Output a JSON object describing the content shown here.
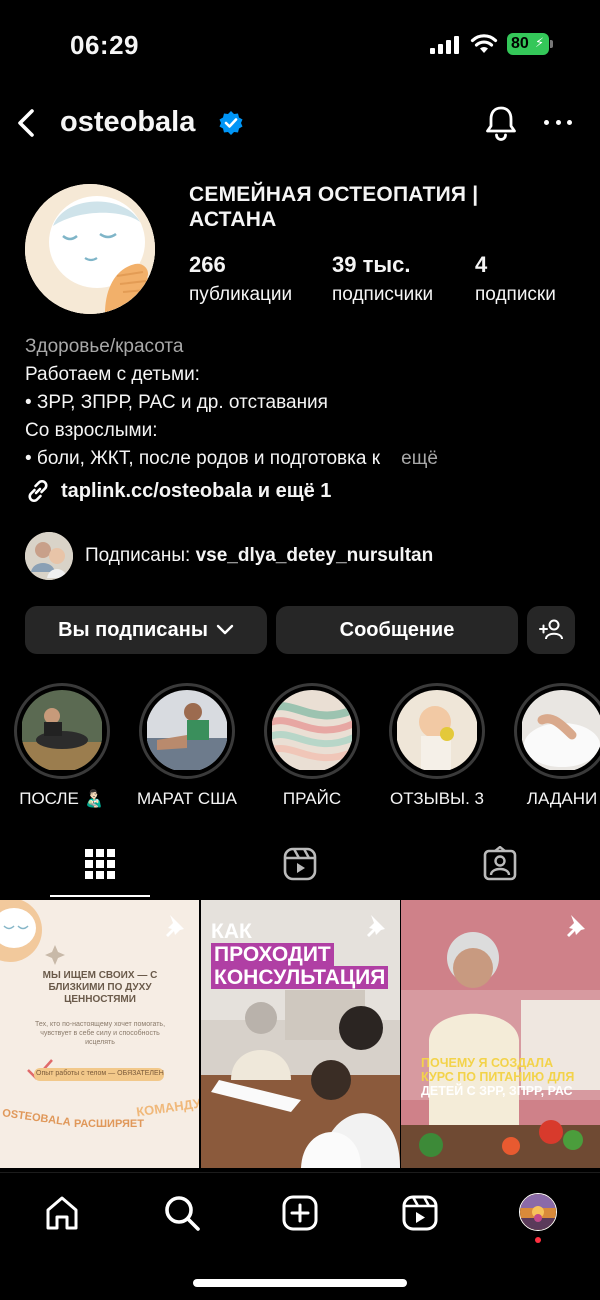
{
  "status_bar": {
    "time": "06:29",
    "battery": "80"
  },
  "header": {
    "username": "osteobala"
  },
  "profile": {
    "name": "СЕМЕЙНАЯ ОСТЕОПАТИЯ | АСТАНА",
    "stats": [
      {
        "value": "266",
        "label": "публикации"
      },
      {
        "value": "39 тыс.",
        "label": "подписчики"
      },
      {
        "value": "4",
        "label": "подписки"
      }
    ],
    "bio": {
      "category": "Здоровье/красота",
      "lines": [
        "Работаем с детьми:",
        "• ЗРР, ЗПРР, РАС и др. отставания",
        "Со взрослыми:",
        "• боли, ЖКТ, после родов и подготовка к"
      ],
      "more": "ещё"
    },
    "link": "taplink.cc/osteobala и ещё 1",
    "followed_by_prefix": "Подписаны:",
    "followed_by_user": "vse_dlya_detey_nursultan"
  },
  "buttons": {
    "following": "Вы подписаны",
    "message": "Сообщение"
  },
  "highlights": [
    {
      "label": "ПОСЛЕ 👨🏻‍🍼"
    },
    {
      "label": "МАРАТ США"
    },
    {
      "label": "ПРАЙС"
    },
    {
      "label": "ОТЗЫВЫ. 3"
    },
    {
      "label": "ЛАДАНИ"
    }
  ],
  "posts": [
    {
      "headline": "МЫ ИЩЕМ СВОИХ — С БЛИЗКИМИ ПО ДУХУ ЦЕННОСТЯМИ",
      "sub": "Тех, кто по-настоящему хочет помогать, чувствует в себе силу и способность исцелять",
      "tag": "Опыт работы с телом — ОБЯЗАТЕЛЕН",
      "footer_left": "OSTEOBALA",
      "footer_mid": "РАСШИРЯЕТ",
      "footer_right": "КОМАНДУ"
    },
    {
      "line1": "КАК",
      "line2": "ПРОХОДИТ",
      "line3": "КОНСУЛЬТАЦИЯ"
    },
    {
      "caption_1": "ПОЧЕМУ Я СОЗДАЛА",
      "caption_2": "КУРС ПО ПИТАНИЮ ДЛЯ",
      "caption_3": "ДЕТЕЙ С ЗРР, ЗПРР, РАС"
    }
  ],
  "colors": {
    "background": "#000000",
    "button_bg": "#262626",
    "verified": "#0095f6",
    "battery": "#34c759",
    "secondary_text": "#a8a8a8"
  }
}
